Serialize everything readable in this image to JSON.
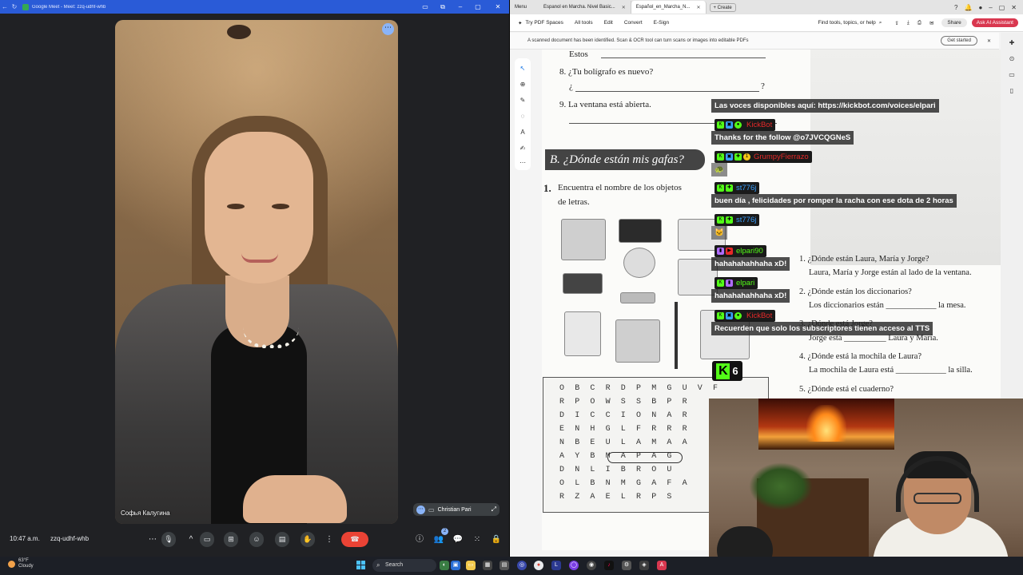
{
  "meet": {
    "tab_title": "Google Meet - Meet: zzq-udhf-whb",
    "participant_name": "Софья Калугина",
    "self_view_name": "Christian Pari",
    "time": "10:47 a.m.",
    "meeting_code": "zzq-udhf-whb",
    "people_count": "2"
  },
  "acrobat": {
    "menu_label": "Menu",
    "tabs": [
      {
        "label": "Espanol en Marcha. Nivel Basic...",
        "active": false
      },
      {
        "label": "Español_en_Marcha_N...",
        "active": true
      }
    ],
    "create_label": "Create",
    "toolbar": {
      "try_pdf": "Try PDF Spaces",
      "all_tools": "All tools",
      "edit": "Edit",
      "convert": "Convert",
      "esign": "E-Sign",
      "search_placeholder": "Find tools, topics, or help",
      "share": "Share",
      "ai_assistant": "Ask AI Assistant"
    },
    "banner": {
      "message": "A scanned document has been identified. Scan & OCR tool can turn scans or images into editable PDFs",
      "button": "Get started"
    }
  },
  "document": {
    "line_estos": "Estos",
    "q8": "8. ¿Tu bolígrafo es nuevo?",
    "q8_answer_open": "¿",
    "q8_answer_close": "?",
    "q9": "9. La ventana está abierta.",
    "section_b": "B. ¿Dónde están mis gafas?",
    "exercise_1_num": "1.",
    "exercise_1_line1": "Encuentra el nombre de los objetos",
    "exercise_1_line2": "de letras.",
    "right_q1": "1. ¿Dónde están Laura, María y Jorge?",
    "right_a1": "Laura, María y Jorge están al lado de la ventana.",
    "right_q2": "2. ¿Dónde están los diccionarios?",
    "right_a2": "Los diccionarios están ____________ la mesa.",
    "right_q3": "3. ¿Dónde está Jorge?",
    "right_a3": "Jorge está __________ Laura y María.",
    "right_q4": "4. ¿Dónde está la mochila de Laura?",
    "right_a4": "La mochila de Laura está ____________ la silla.",
    "right_q5": "5. ¿Dónde está el cuaderno?",
    "wordsearch_rows": [
      "OBCRDPMGUVF",
      "RPOWSSBPR",
      "DICCIONAR",
      "ENHGLFRRR",
      "NBEULAMAA",
      "AYBMAPAG",
      "DNLIBROU",
      "OLBNMGAFA",
      "RZAELRPS"
    ]
  },
  "chat": [
    {
      "user": "",
      "message": "Las voces disponibles aquí: https://kickbot.com/voices/elpari"
    },
    {
      "user": "KickBot",
      "message": "Thanks for the follow @o7JVCQGNeS"
    },
    {
      "user": "GrumpyFierrazo",
      "message": "🐢"
    },
    {
      "user": "st776j",
      "message": "buen día , felicidades por romper la racha con ese dota de 2 horas"
    },
    {
      "user": "st776j",
      "message": "🐱"
    },
    {
      "user": "elpari90",
      "message": "hahahahahhaha xD!"
    },
    {
      "user": "elpari",
      "message": "hahahahahhaha xD!"
    },
    {
      "user": "KickBot",
      "message": "Recuerden que solo los subscriptores tienen acceso al TTS"
    }
  ],
  "kick_viewers": "6",
  "taskbar": {
    "temperature": "63°F",
    "condition": "Cloudy",
    "search_label": "Search"
  },
  "colors": {
    "kick_green": "#53fc18",
    "bot_name_red": "#e52929",
    "user_blue": "#3aa0ff",
    "meet_end_call": "#ea4335",
    "acrobat_red": "#d9374f"
  }
}
